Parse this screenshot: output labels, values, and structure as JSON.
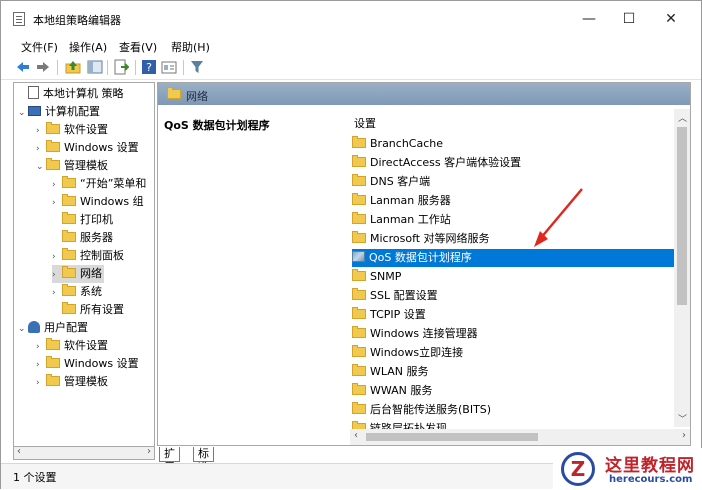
{
  "window": {
    "title": "本地组策略编辑器",
    "minimize": "—",
    "maximize": "☐",
    "close": "✕"
  },
  "menu": [
    "文件(F)",
    "操作(A)",
    "查看(V)",
    "帮助(H)"
  ],
  "tree": [
    {
      "label": "本地计算机 策略",
      "level": 0,
      "arrow": "",
      "icon": "policy-doc-icon"
    },
    {
      "label": "计算机配置",
      "level": 0,
      "arrow": "⌄",
      "icon": "computer-icon"
    },
    {
      "label": "软件设置",
      "level": 1,
      "arrow": "›",
      "icon": "folder-icon"
    },
    {
      "label": "Windows 设置",
      "level": 1,
      "arrow": "›",
      "icon": "folder-icon"
    },
    {
      "label": "管理模板",
      "level": 1,
      "arrow": "⌄",
      "icon": "folder-icon"
    },
    {
      "label": "“开始”菜单和",
      "level": 2,
      "arrow": "›",
      "icon": "folder-icon"
    },
    {
      "label": "Windows 组",
      "level": 2,
      "arrow": "›",
      "icon": "folder-icon"
    },
    {
      "label": "打印机",
      "level": 2,
      "arrow": "",
      "icon": "folder-icon"
    },
    {
      "label": "服务器",
      "level": 2,
      "arrow": "",
      "icon": "folder-icon"
    },
    {
      "label": "控制面板",
      "level": 2,
      "arrow": "›",
      "icon": "folder-icon"
    },
    {
      "label": "网络",
      "level": 2,
      "arrow": "›",
      "icon": "folder-icon",
      "selected": true
    },
    {
      "label": "系统",
      "level": 2,
      "arrow": "›",
      "icon": "folder-icon"
    },
    {
      "label": "所有设置",
      "level": 2,
      "arrow": "",
      "icon": "settings-folder-icon"
    },
    {
      "label": "用户配置",
      "level": 0,
      "arrow": "⌄",
      "icon": "user-icon"
    },
    {
      "label": "软件设置",
      "level": 1,
      "arrow": "›",
      "icon": "folder-icon"
    },
    {
      "label": "Windows 设置",
      "level": 1,
      "arrow": "›",
      "icon": "folder-icon"
    },
    {
      "label": "管理模板",
      "level": 1,
      "arrow": "›",
      "icon": "folder-icon"
    }
  ],
  "right": {
    "header": "网络",
    "description_title": "QoS 数据包计划程序",
    "list_header": "设置",
    "items": [
      {
        "label": "BranchCache",
        "icon": "folder-icon"
      },
      {
        "label": "DirectAccess 客户端体验设置",
        "icon": "folder-icon"
      },
      {
        "label": "DNS 客户端",
        "icon": "folder-icon"
      },
      {
        "label": "Lanman 服务器",
        "icon": "folder-icon"
      },
      {
        "label": "Lanman 工作站",
        "icon": "folder-icon"
      },
      {
        "label": "Microsoft 对等网络服务",
        "icon": "folder-icon"
      },
      {
        "label": "QoS 数据包计划程序",
        "icon": "policy-folder-icon",
        "selected": true
      },
      {
        "label": "SNMP",
        "icon": "folder-icon"
      },
      {
        "label": "SSL 配置设置",
        "icon": "folder-icon"
      },
      {
        "label": "TCPIP 设置",
        "icon": "folder-icon"
      },
      {
        "label": "Windows 连接管理器",
        "icon": "folder-icon"
      },
      {
        "label": "Windows立即连接",
        "icon": "folder-icon"
      },
      {
        "label": "WLAN 服务",
        "icon": "folder-icon"
      },
      {
        "label": "WWAN 服务",
        "icon": "folder-icon"
      },
      {
        "label": "后台智能传送服务(BITS)",
        "icon": "folder-icon"
      },
      {
        "label": "链路层拓扑发现",
        "icon": "folder-icon"
      }
    ]
  },
  "tabs": [
    "扩展",
    "标准"
  ],
  "status": "1 个设置",
  "watermark": {
    "cn": "这里教程网",
    "en": "herecours.com"
  },
  "colors": {
    "selection": "#0078d7",
    "annotation_arrow": "#e0281e"
  }
}
